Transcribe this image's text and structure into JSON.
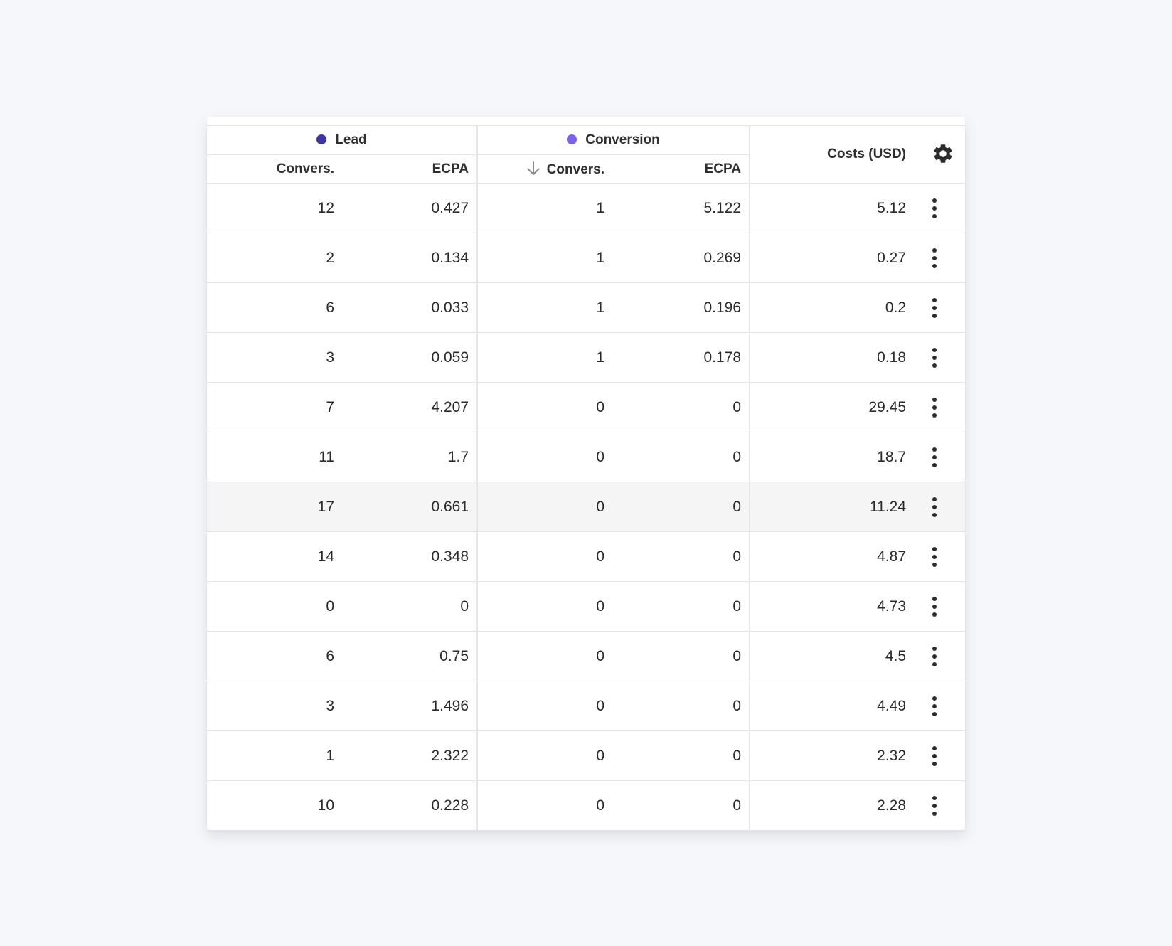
{
  "header": {
    "groups": [
      {
        "label": "Lead",
        "dot_color": "#3d34a5"
      },
      {
        "label": "Conversion",
        "dot_color": "#7b62e8"
      }
    ],
    "sub_columns": [
      "Convers.",
      "ECPA",
      "Convers.",
      "ECPA"
    ],
    "costs_label": "Costs (USD)",
    "sort_indicator": "arrow-down-icon",
    "settings_icon": "gear-icon"
  },
  "rows": [
    {
      "lead_convers": "12",
      "lead_ecpa": "0.427",
      "conv_convers": "1",
      "conv_ecpa": "5.122",
      "costs": "5.12"
    },
    {
      "lead_convers": "2",
      "lead_ecpa": "0.134",
      "conv_convers": "1",
      "conv_ecpa": "0.269",
      "costs": "0.27"
    },
    {
      "lead_convers": "6",
      "lead_ecpa": "0.033",
      "conv_convers": "1",
      "conv_ecpa": "0.196",
      "costs": "0.2"
    },
    {
      "lead_convers": "3",
      "lead_ecpa": "0.059",
      "conv_convers": "1",
      "conv_ecpa": "0.178",
      "costs": "0.18"
    },
    {
      "lead_convers": "7",
      "lead_ecpa": "4.207",
      "conv_convers": "0",
      "conv_ecpa": "0",
      "costs": "29.45"
    },
    {
      "lead_convers": "11",
      "lead_ecpa": "1.7",
      "conv_convers": "0",
      "conv_ecpa": "0",
      "costs": "18.7"
    },
    {
      "lead_convers": "17",
      "lead_ecpa": "0.661",
      "conv_convers": "0",
      "conv_ecpa": "0",
      "costs": "11.24"
    },
    {
      "lead_convers": "14",
      "lead_ecpa": "0.348",
      "conv_convers": "0",
      "conv_ecpa": "0",
      "costs": "4.87"
    },
    {
      "lead_convers": "0",
      "lead_ecpa": "0",
      "conv_convers": "0",
      "conv_ecpa": "0",
      "costs": "4.73"
    },
    {
      "lead_convers": "6",
      "lead_ecpa": "0.75",
      "conv_convers": "0",
      "conv_ecpa": "0",
      "costs": "4.5"
    },
    {
      "lead_convers": "3",
      "lead_ecpa": "1.496",
      "conv_convers": "0",
      "conv_ecpa": "0",
      "costs": "4.49"
    },
    {
      "lead_convers": "1",
      "lead_ecpa": "2.322",
      "conv_convers": "0",
      "conv_ecpa": "0",
      "costs": "2.32"
    },
    {
      "lead_convers": "10",
      "lead_ecpa": "0.228",
      "conv_convers": "0",
      "conv_ecpa": "0",
      "costs": "2.28"
    }
  ],
  "row_menu_icon": "more-vertical-icon",
  "colors": {
    "background": "#f6f7fb",
    "hover_row": "#f5f5f5",
    "border": "#e3e3e3"
  }
}
